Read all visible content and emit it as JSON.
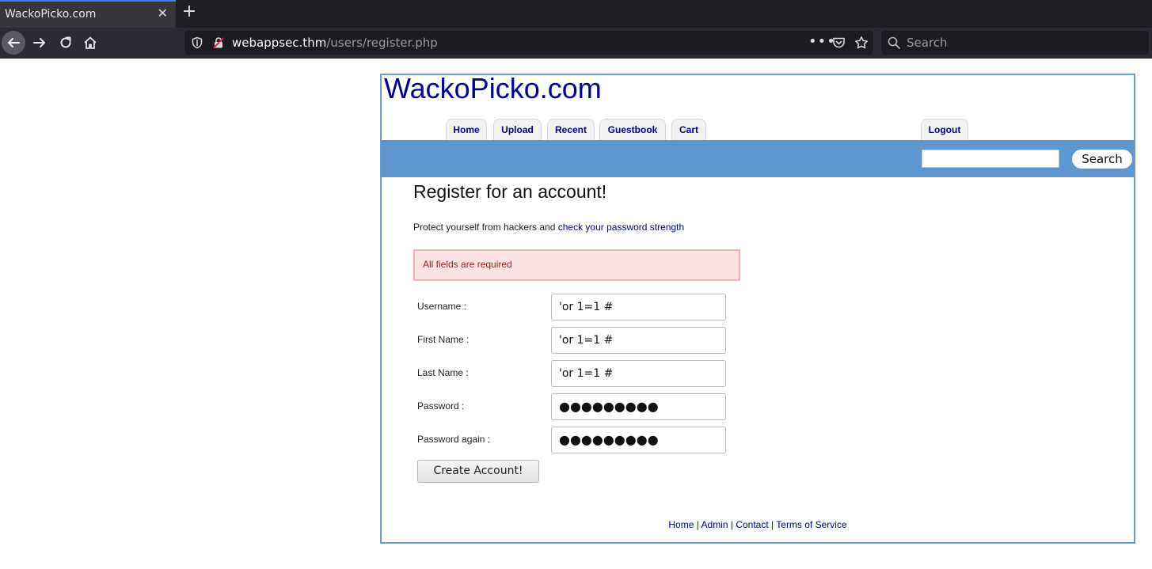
{
  "browser": {
    "tab_title": "WackoPicko.com",
    "tab_close": "✕",
    "new_tab": "+",
    "url_host": "webappsec.thm",
    "url_path": "/users/register.php",
    "url_more": "•••",
    "search_placeholder": "Search"
  },
  "site": {
    "title": "WackoPicko.com",
    "nav": [
      "Home",
      "Upload",
      "Recent",
      "Guestbook",
      "Cart"
    ],
    "logout": "Logout",
    "search_button": "Search"
  },
  "register": {
    "heading": "Register for an account!",
    "protect_text": "Protect yourself from hackers and ",
    "protect_link": "check your password strength",
    "error": "All fields are required",
    "fields": [
      {
        "label": "Username :",
        "value": "'or 1=1 #"
      },
      {
        "label": "First Name :",
        "value": "'or 1=1 #"
      },
      {
        "label": "Last Name :",
        "value": "'or 1=1 #"
      },
      {
        "label": "Password :",
        "value": "●●●●●●●●●"
      },
      {
        "label": "Password again :",
        "value": "●●●●●●●●●"
      }
    ],
    "submit": "Create Account!"
  },
  "footer": {
    "links": [
      "Home",
      "Admin",
      "Contact",
      "Terms of Service"
    ],
    "separator": " | "
  },
  "colors": {
    "link": "#000099",
    "band": "#5e96d0",
    "frame_border": "#6a9bd0",
    "error_bg": "#fde3e3",
    "error_text": "#9a1c1c"
  },
  "icons": [
    "back-arrow-icon",
    "forward-arrow-icon",
    "reload-icon",
    "home-icon",
    "shield-icon",
    "insecure-lock-icon",
    "pocket-icon",
    "star-icon",
    "search-icon"
  ]
}
